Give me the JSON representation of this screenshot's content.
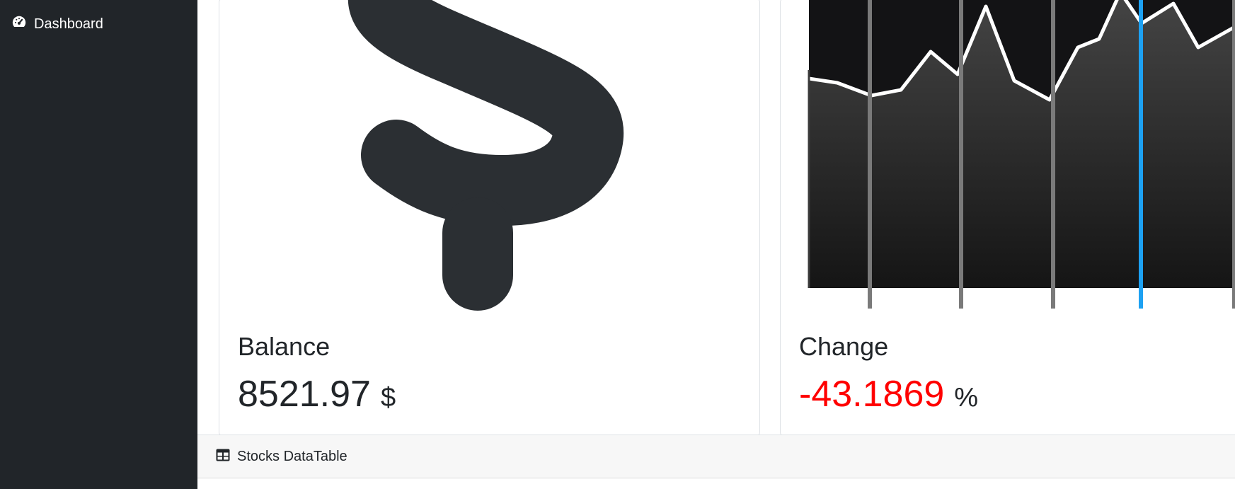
{
  "sidebar": {
    "items": [
      {
        "label": "Dashboard",
        "icon": "speedometer-icon"
      }
    ]
  },
  "cards": {
    "balance": {
      "icon": "dollar-sign-icon",
      "title": "Balance",
      "value": "8521.97",
      "unit": "$"
    },
    "change": {
      "icon": "line-chart-icon",
      "title": "Change",
      "value": "-43.1869",
      "unit": "%",
      "value_color": "#ff0000"
    }
  },
  "datatable": {
    "icon": "table-icon",
    "title": "Stocks DataTable"
  },
  "colors": {
    "sidebar_bg": "#212529",
    "accent_blue": "#1da1f2",
    "negative": "#ff0000"
  }
}
